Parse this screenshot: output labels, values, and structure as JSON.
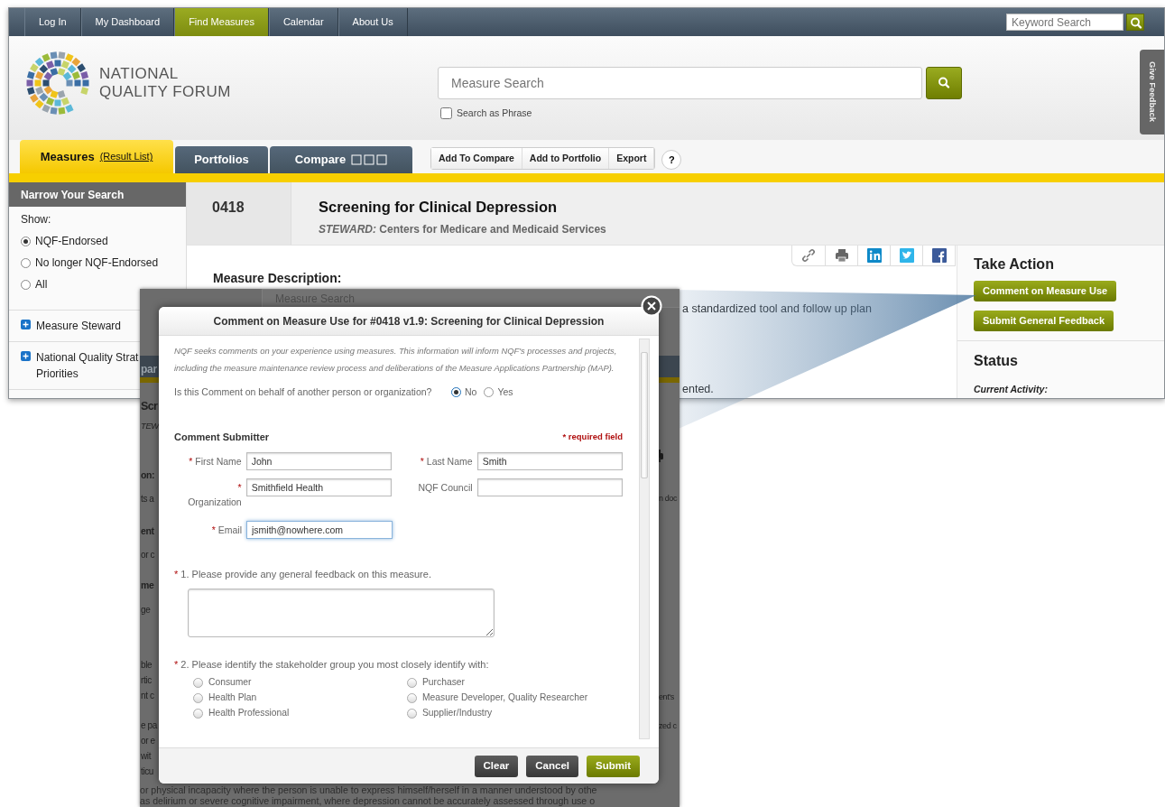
{
  "top_nav": {
    "items": [
      {
        "label": "Log In",
        "selected": false
      },
      {
        "label": "My Dashboard",
        "selected": false
      },
      {
        "label": "Find Measures",
        "selected": true
      },
      {
        "label": "Calendar",
        "selected": false
      },
      {
        "label": "About Us",
        "selected": false
      }
    ],
    "keyword_search": {
      "placeholder": "Keyword Search"
    }
  },
  "header": {
    "logo_lines": [
      "NATIONAL",
      "QUALITY FORUM"
    ],
    "measure_search": {
      "placeholder": "Measure Search"
    },
    "search_as_phrase": {
      "label": "Search as Phrase",
      "checked": false
    },
    "feedback_tab": "Give Feedback"
  },
  "tabs": [
    {
      "label": "Measures",
      "link": "(Result List)",
      "selected": true
    },
    {
      "label": "Portfolios",
      "selected": false
    },
    {
      "label": "Compare",
      "selected": false
    }
  ],
  "toolbar_buttons": [
    "Add To Compare",
    "Add to Portfolio",
    "Export"
  ],
  "help_button": "?",
  "sidebar": {
    "title": "Narrow Your Search",
    "show_label": "Show:",
    "options": [
      {
        "label": "NQF-Endorsed",
        "selected": true
      },
      {
        "label": "No longer NQF-Endorsed",
        "selected": false
      },
      {
        "label": "All",
        "selected": false
      }
    ],
    "filters": [
      {
        "lines": [
          "Measure Steward"
        ]
      },
      {
        "lines": [
          "National Quality Strat",
          "Priorities"
        ]
      }
    ]
  },
  "measure": {
    "number": "0418",
    "title": "Screening for Clinical Depression",
    "steward_label": "STEWARD:",
    "steward": "Centers for Medicare and Medicaid Services"
  },
  "description": {
    "heading": "Measure Description:",
    "visible_lines": [
      "a standardized tool and follow up plan",
      "ented."
    ]
  },
  "take_action": {
    "title": "Take Action",
    "buttons": [
      "Comment on Measure Use",
      "Submit General Feedback"
    ]
  },
  "status": {
    "title": "Status",
    "current_activity_label": "Current Activity:"
  },
  "backdrop": {
    "search_text": "Measure Search",
    "tab_fragment": "par",
    "left_fragments": [
      {
        "text": "Scr",
        "kind": "heading"
      },
      {
        "text": "TEW",
        "kind": "italic"
      },
      {
        "text": "on:",
        "kind": "bold"
      },
      {
        "text": "ts a",
        "kind": "plain"
      },
      {
        "text": "ent",
        "kind": "bold"
      },
      {
        "text": "or c",
        "kind": "plain"
      },
      {
        "text": "me",
        "kind": "bold"
      },
      {
        "text": "ge",
        "kind": "plain"
      },
      {
        "text": "ble",
        "kind": "plain"
      },
      {
        "text": "rtic",
        "kind": "plain"
      },
      {
        "text": "nt c",
        "kind": "plain"
      },
      {
        "text": "e pa",
        "kind": "plain"
      },
      {
        "text": "or e",
        "kind": "plain"
      },
      {
        "text": "wit",
        "kind": "plain"
      },
      {
        "text": "ticu",
        "kind": "plain"
      }
    ],
    "right_fragments": [
      "n doc",
      "ent's",
      "zed c"
    ],
    "bottom_lines": [
      "or physical incapacity where the person is unable to express himself/herself in a manner understood by othe",
      "as delirium or severe cognitive impairment, where depression cannot be accurately assessed through use o"
    ]
  },
  "dialog": {
    "title": "Comment on Measure Use for #0418 v1.9: Screening for Clinical Depression",
    "intro": "NQF seeks comments on your experience using measures. This information will inform NQF's processes and projects, including the measure maintenance review process and deliberations of the Measure Applications Partnership (MAP).",
    "behalf": {
      "question": "Is this Comment on behalf of another person or organization?",
      "options": [
        {
          "label": "No",
          "selected": true
        },
        {
          "label": "Yes",
          "selected": false
        }
      ]
    },
    "section_title": "Comment Submitter",
    "required_note": "* required field",
    "fields": [
      {
        "mark": "*",
        "label": "First Name",
        "value": "John",
        "focused": false
      },
      {
        "mark": "*",
        "label": "Last Name",
        "value": "Smith",
        "focused": false
      },
      {
        "mark": "*",
        "label": "Organization",
        "value": "Smithfield Health",
        "focused": false
      },
      {
        "label": "NQF Council",
        "focused": false
      },
      {
        "mark": "*",
        "label": "Email",
        "value": "jsmith@nowhere.com",
        "focused": true
      }
    ],
    "questions": [
      {
        "mark": "*",
        "text": "1. Please provide any general feedback on this measure.",
        "kind": "textarea"
      },
      {
        "mark": "*",
        "text": "2. Please identify the stakeholder group you most closely identify with:",
        "kind": "radio",
        "options": [
          {
            "label": "Consumer",
            "selected": false
          },
          {
            "label": "Purchaser",
            "selected": false
          },
          {
            "label": "Health Plan",
            "selected": false
          },
          {
            "label": "Measure Developer, Quality Researcher",
            "selected": false
          },
          {
            "label": "Health Professional",
            "selected": false
          },
          {
            "label": "Supplier/Industry",
            "selected": false
          }
        ]
      }
    ],
    "buttons": [
      {
        "label": "Clear",
        "kind": "secondary"
      },
      {
        "label": "Cancel",
        "kind": "secondary"
      },
      {
        "label": "Submit",
        "kind": "primary"
      }
    ]
  }
}
